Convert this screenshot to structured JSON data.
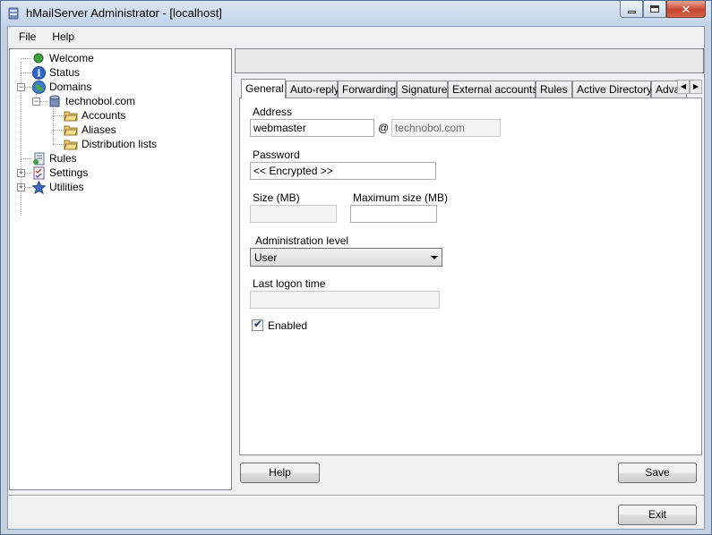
{
  "window": {
    "title": "hMailServer Administrator - [localhost]"
  },
  "menu": {
    "items": [
      "File",
      "Help"
    ]
  },
  "tree": {
    "welcome": "Welcome",
    "status": "Status",
    "domains": "Domains",
    "domain": "technobol.com",
    "accounts": "Accounts",
    "aliases": "Aliases",
    "distribution_lists": "Distribution lists",
    "rules": "Rules",
    "settings": "Settings",
    "utilities": "Utilities"
  },
  "tabs": [
    "General",
    "Auto-reply",
    "Forwarding",
    "Signature",
    "External accounts",
    "Rules",
    "Active Directory",
    "Adva"
  ],
  "active_tab": "General",
  "form": {
    "address_label": "Address",
    "address_value": "webmaster",
    "at_sign": "@",
    "domain_value": "technobol.com",
    "password_label": "Password",
    "password_value": "<< Encrypted >>",
    "size_label": "Size (MB)",
    "size_value": "",
    "max_size_label": "Maximum size (MB)",
    "max_size_value": "",
    "admin_level_label": "Administration level",
    "admin_level_value": "User",
    "last_logon_label": "Last logon time",
    "last_logon_value": "",
    "enabled_label": "Enabled",
    "enabled_checked": true
  },
  "buttons": {
    "help": "Help",
    "save": "Save",
    "exit": "Exit"
  },
  "icons": {
    "app": "server-icon",
    "minimize": "minimize-icon",
    "maximize": "maximize-icon",
    "close": "close-icon"
  }
}
